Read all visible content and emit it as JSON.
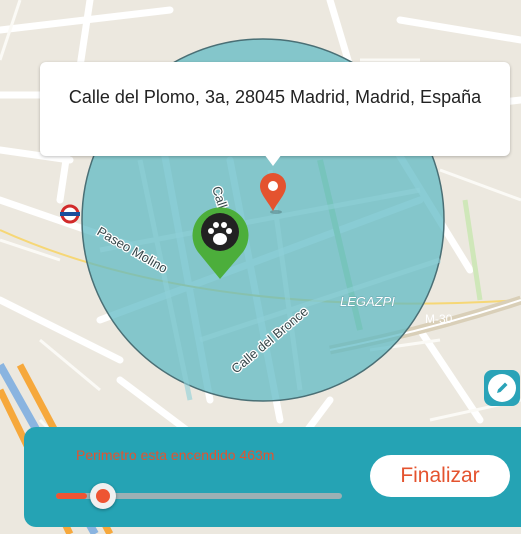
{
  "map": {
    "address": "Calle del Plomo, 3a, 28045 Madrid, Madrid, España",
    "street_labels": {
      "paseo_molino": "Paseo Molino",
      "calle_del_bronce": "Calle del Bronce",
      "calle_hierro": "Calle Hierro",
      "legazpi": "LEGAZPI",
      "m30": "M-30"
    },
    "perimeter_color": "#5bb8c4",
    "pet_marker_color": "#4cae3b",
    "location_marker_color": "#e4532f",
    "pet_icon": "paw-icon",
    "location_icon": "map-pin-icon"
  },
  "edit_button": {
    "icon": "pencil-icon"
  },
  "panel": {
    "status_text": "Perimetro esta encendido 463m",
    "finish_label": "Finalizar",
    "slider_fraction": 0.11,
    "accent_color": "#e4532f",
    "background_color": "#25a3b4"
  }
}
